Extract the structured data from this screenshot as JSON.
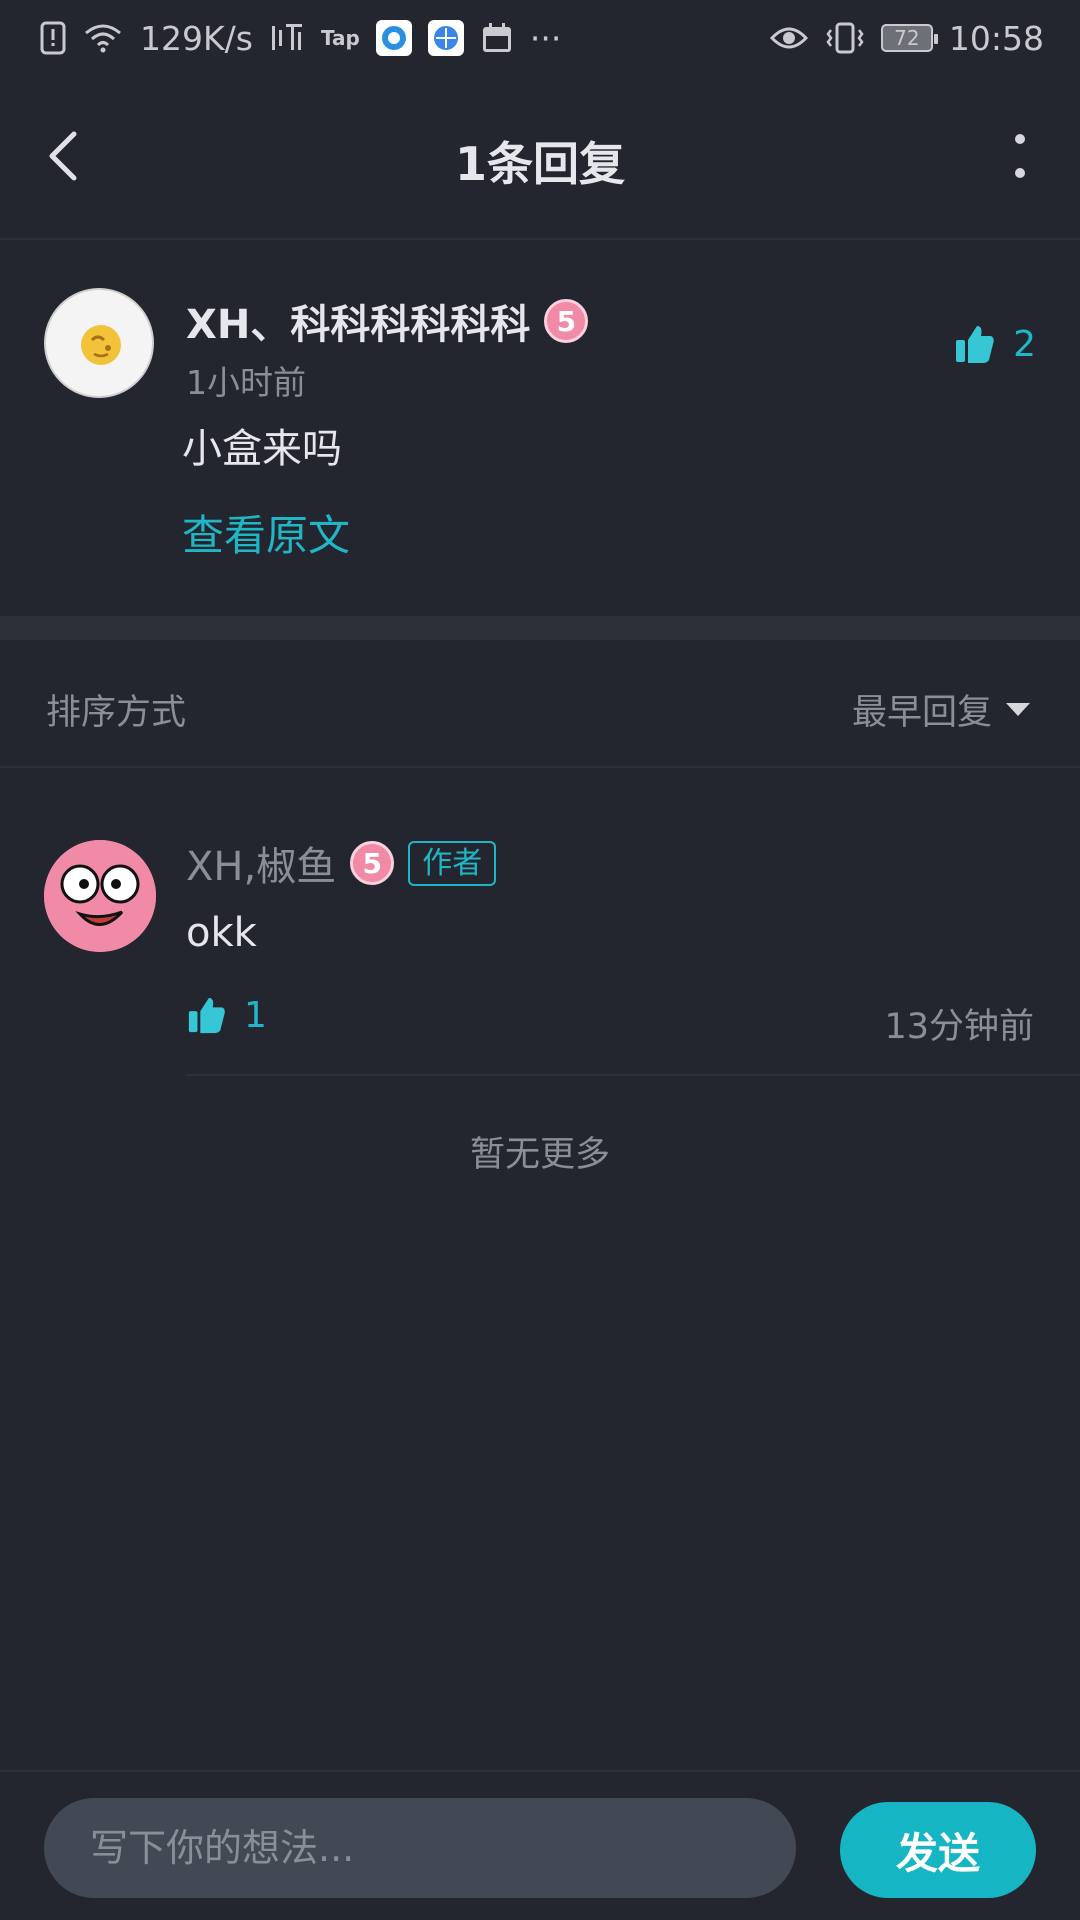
{
  "status_bar": {
    "net_speed": "129K/s",
    "battery": "72",
    "time": "10:58",
    "more": "···",
    "icons": [
      "sim-alert-icon",
      "wifi-icon",
      "listen-app-icon",
      "taptap-app-icon",
      "app-icon-1",
      "app-icon-2",
      "calendar-icon",
      "eye-icon",
      "vibrate-icon",
      "battery-icon"
    ],
    "tap_label": "Tap"
  },
  "header": {
    "title": "1条回复"
  },
  "comment": {
    "username": "XH、科科科科科科",
    "level": "5",
    "time": "1小时前",
    "text": "小盒来吗",
    "likes": "2",
    "view_original": "查看原文"
  },
  "sort": {
    "label": "排序方式",
    "selected": "最早回复"
  },
  "reply": {
    "username": "XH,椒鱼",
    "level": "5",
    "author_tag": "作者",
    "text": "okk",
    "likes": "1",
    "time": "13分钟前"
  },
  "footer_note": "暂无更多",
  "input": {
    "placeholder": "写下你的想法...",
    "send_label": "发送"
  },
  "colors": {
    "background": "#24262f",
    "accent": "#16b5c4",
    "level_badge": "#f08aa6"
  }
}
